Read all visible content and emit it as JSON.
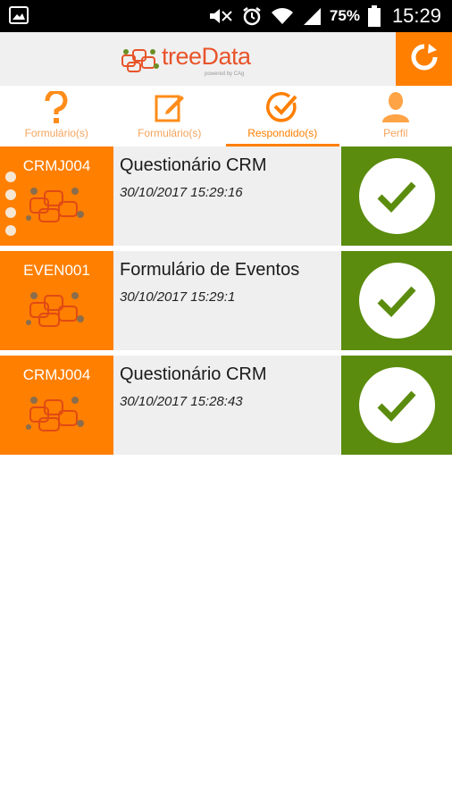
{
  "status_bar": {
    "battery_percent": "75%",
    "time": "15:29",
    "icons": [
      "gallery-icon",
      "mute-icon",
      "alarm-icon",
      "wifi-icon",
      "signal-icon",
      "battery-icon"
    ]
  },
  "header": {
    "logo_text": "treeData",
    "logo_subtext": "powered by CAg",
    "refresh_icon": "refresh-icon",
    "accent_color": "#ff7f00"
  },
  "tabs": [
    {
      "label": "Formulário(s)",
      "icon": "question-mark-icon",
      "active": false
    },
    {
      "label": "Formulário(s)",
      "icon": "edit-form-icon",
      "active": false
    },
    {
      "label": "Respondido(s)",
      "icon": "check-circle-icon",
      "active": true
    },
    {
      "label": "Perfil",
      "icon": "user-icon",
      "active": false
    }
  ],
  "rows": [
    {
      "code": "CRMJ004",
      "title": "Questionário CRM",
      "date": "30/10/2017 15:29:16",
      "status_icon": "check-icon"
    },
    {
      "code": "EVEN001",
      "title": "Formulário de Eventos",
      "date": "30/10/2017 15:29:1",
      "status_icon": "check-icon"
    },
    {
      "code": "CRMJ004",
      "title": "Questionário CRM",
      "date": "30/10/2017 15:28:43",
      "status_icon": "check-icon"
    }
  ],
  "colors": {
    "orange": "#ff7f00",
    "green": "#5b8c0e",
    "row_bg": "#efefef"
  }
}
